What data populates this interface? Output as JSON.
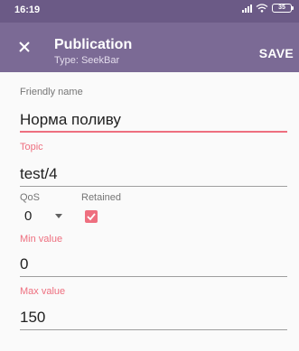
{
  "status_bar": {
    "time": "16:19",
    "battery": "35"
  },
  "app_bar": {
    "title": "Publication",
    "subtitle": "Type: SeekBar",
    "save_label": "SAVE",
    "close_icon": "close-icon"
  },
  "form": {
    "friendly_name": {
      "label": "Friendly name",
      "value": "Норма поливу"
    },
    "topic": {
      "label": "Topic",
      "value": "test/4"
    },
    "qos": {
      "label": "QoS",
      "value": "0"
    },
    "retained": {
      "label": "Retained",
      "checked": true
    },
    "min_value": {
      "label": "Min value",
      "value": "0"
    },
    "max_value": {
      "label": "Max value",
      "value": "150"
    }
  },
  "colors": {
    "status_bar": "#6b5a86",
    "app_bar": "#7b6a95",
    "accent": "#ee6f7f",
    "background": "#fafafa"
  }
}
